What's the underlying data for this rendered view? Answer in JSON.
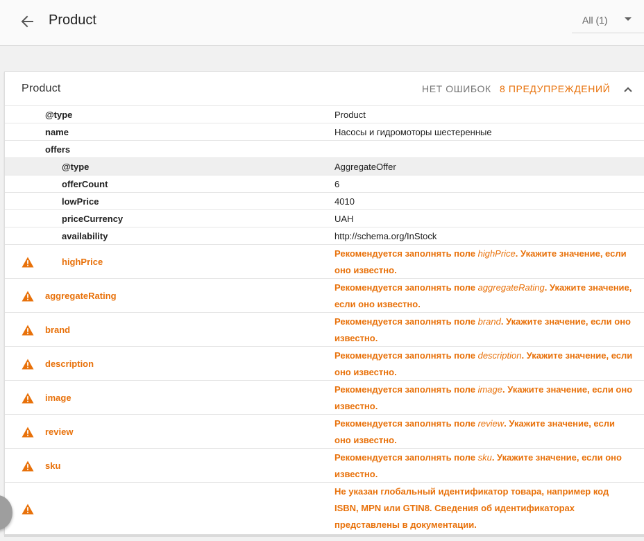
{
  "header": {
    "title": "Product",
    "filter_label": "All (1)"
  },
  "card": {
    "title": "Product",
    "no_errors": "НЕТ ОШИБОК",
    "warnings": "8 ПРЕДУПРЕЖДЕНИЙ"
  },
  "rows": [
    {
      "key": "@type",
      "value": "Product"
    },
    {
      "key": "name",
      "value": "Насосы и гидромоторы шестеренные"
    },
    {
      "key": "offers",
      "value": ""
    }
  ],
  "offers": [
    {
      "key": "@type",
      "value": "AggregateOffer"
    },
    {
      "key": "offerCount",
      "value": "6"
    },
    {
      "key": "lowPrice",
      "value": "4010"
    },
    {
      "key": "priceCurrency",
      "value": "UAH"
    },
    {
      "key": "availability",
      "value": "http://schema.org/InStock"
    }
  ],
  "warning_rows": [
    {
      "key": "highPrice",
      "pre": "Рекомендуется заполнять поле ",
      "field": "highPrice",
      "post": ". Укажите значение, если оно известно."
    },
    {
      "key": "aggregateRating",
      "pre": "Рекомендуется заполнять поле ",
      "field": "aggregateRating",
      "post": ". Укажите значение, если оно известно."
    },
    {
      "key": "brand",
      "pre": "Рекомендуется заполнять поле ",
      "field": "brand",
      "post": ". Укажите значение, если оно известно."
    },
    {
      "key": "description",
      "pre": "Рекомендуется заполнять поле ",
      "field": "description",
      "post": ". Укажите значение, если оно известно."
    },
    {
      "key": "image",
      "pre": "Рекомендуется заполнять поле ",
      "field": "image",
      "post": ". Укажите значение, если оно известно."
    },
    {
      "key": "review",
      "pre": "Рекомендуется заполнять поле ",
      "field": "review",
      "post": ". Укажите значение, если оно известно."
    },
    {
      "key": "sku",
      "pre": "Рекомендуется заполнять поле ",
      "field": "sku",
      "post": ". Укажите значение, если оно известно."
    },
    {
      "key": "",
      "pre": "Не указан глобальный идентификатор товара, например код ISBN, MPN или GTIN8. Сведения об идентификаторах представлены в документации.",
      "field": "",
      "post": ""
    }
  ],
  "icons": {
    "back": "arrow-back-icon",
    "dropdown": "caret-down-icon",
    "collapse": "chevron-up-icon",
    "warning": "warning-triangle-icon"
  },
  "colors": {
    "warning": "#e8710a",
    "muted": "#757575",
    "text": "#212121",
    "shaded_row": "#efefef"
  }
}
